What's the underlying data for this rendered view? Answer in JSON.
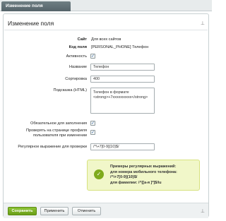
{
  "tab": {
    "label": "Изменение поля"
  },
  "panel": {
    "title": "Изменение поля",
    "pin_glyph": "⊥"
  },
  "fields": {
    "site": {
      "label": "Сайт",
      "value": "Для всех сайтов"
    },
    "code": {
      "label": "Код поля",
      "value": "[PERSONAL_PHONE] Телефон"
    },
    "active": {
      "label": "Активность",
      "checked": true
    },
    "name": {
      "label": "Название",
      "value": "Телефон"
    },
    "sort": {
      "label": "Сортировка",
      "value": "400"
    },
    "tooltip": {
      "label": "Подсказка (HTML)",
      "line1": "Телефон в формате",
      "line2": "<strong>+7xxxxxxxxxx</strong>"
    },
    "required": {
      "label": "Обязательное для заполнения",
      "checked": true
    },
    "check_profile": {
      "label_line1": "Проверять на странице профиля",
      "label_line2": "пользователя при изменении",
      "checked": true
    },
    "regex": {
      "label": "Регулярное выражение для проверки",
      "value": "/^\\+7[0-9]{10}$/"
    }
  },
  "hint": {
    "icon": "check-icon",
    "line1": "Примеры регулярных выражений:",
    "line2": "для номера мобильного телефона:",
    "line3": "/^\\+7[0-9]{10}$/",
    "line4": "для фамилии: /^[[а-я ]*]$/iu"
  },
  "buttons": {
    "save": "Сохранить",
    "apply": "Применить",
    "cancel": "Отменить"
  }
}
